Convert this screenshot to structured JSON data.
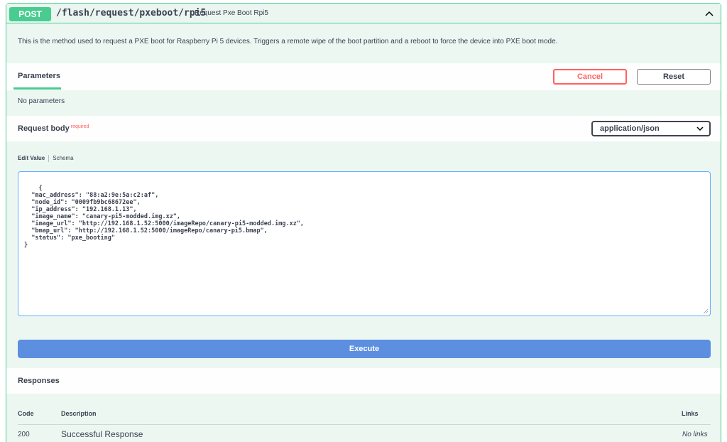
{
  "operation": {
    "method": "POST",
    "path": "/flash/request/pxeboot/rpi5",
    "summary": "Request Pxe Boot Rpi5",
    "description": "This is the method used to request a PXE boot for Raspberry Pi 5 devices. Triggers a remote wipe of the boot partition and a reboot to force the device into PXE boot mode."
  },
  "parameters": {
    "tab_label": "Parameters",
    "cancel_label": "Cancel",
    "reset_label": "Reset",
    "empty_text": "No parameters"
  },
  "request_body": {
    "label": "Request body",
    "required_label": "required",
    "content_type": "application/json",
    "edit_value_tab": "Edit Value",
    "schema_tab": "Schema",
    "value": "{\n  \"mac_address\": \"88:a2:9e:5a:c2:af\",\n  \"node_id\": \"0009fb9bc68672ee\",\n  \"ip_address\": \"192.168.1.13\",\n  \"image_name\": \"canary-pi5-modded.img.xz\",\n  \"image_url\": \"http://192.168.1.52:5000/imageRepo/canary-pi5-modded.img.xz\",\n  \"bmap_url\": \"http://192.168.1.52:5000/imageRepo/canary-pi5.bmap\",\n  \"status\": \"pxe_booting\"\n}"
  },
  "execute_label": "Execute",
  "responses": {
    "title": "Responses",
    "headers": {
      "code": "Code",
      "description": "Description",
      "links": "Links"
    },
    "rows": [
      {
        "code": "200",
        "description": "Successful Response",
        "links": "No links"
      }
    ]
  },
  "colors": {
    "post_green": "#49cc90",
    "cancel_red": "#ff6060",
    "execute_blue": "#5d8fe0",
    "editor_border": "#61affe"
  },
  "icons": {
    "collapse": "chevron-up-icon",
    "select": "chevron-down-icon",
    "resize": "resize-grip-icon"
  }
}
